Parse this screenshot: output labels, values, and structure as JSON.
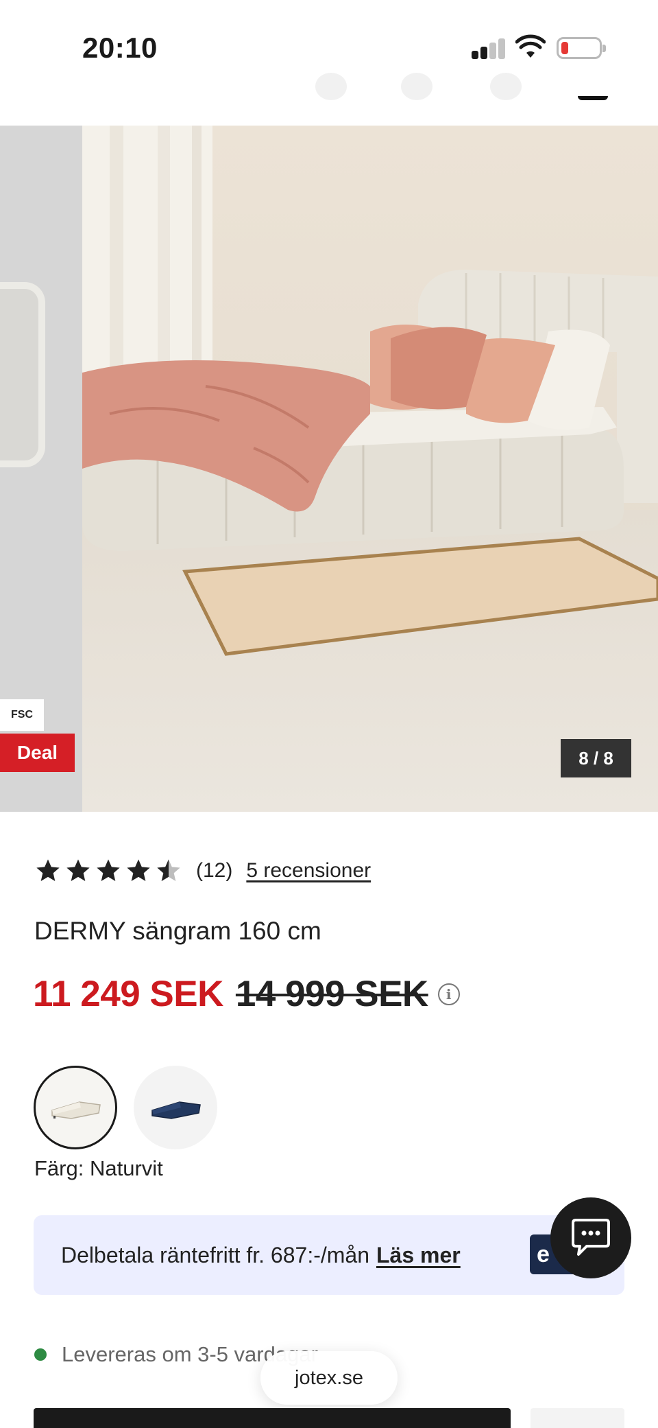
{
  "status_bar": {
    "time": "20:10"
  },
  "gallery": {
    "badge_fsc": "FSC",
    "badge_deal": "Deal",
    "counter": "8 / 8"
  },
  "product": {
    "rating_value": 4.5,
    "rating_count": "(12)",
    "reviews_link": "5 recensioner",
    "title": "DERMY sängram 160 cm",
    "price_current": "11 249 SEK",
    "price_old": "14 999 SEK",
    "color_label": "Färg: Naturvit",
    "swatches": [
      "naturvit",
      "blå"
    ]
  },
  "payment": {
    "text": "Delbetala räntefritt fr. 687:-/mån",
    "link": "Läs mer",
    "logo_text": "e"
  },
  "delivery": {
    "text": "Levereras om 3-5 vardagar"
  },
  "browser": {
    "url": "jotex.se"
  },
  "colors": {
    "accent_red": "#cc1a1f",
    "deal_red": "#d51f26",
    "delivery_green": "#2e8b43",
    "banner_bg": "#eceeff"
  },
  "icons": [
    "cellular-signal-icon",
    "wifi-icon",
    "battery-icon",
    "star-icon",
    "info-icon",
    "chat-icon"
  ]
}
